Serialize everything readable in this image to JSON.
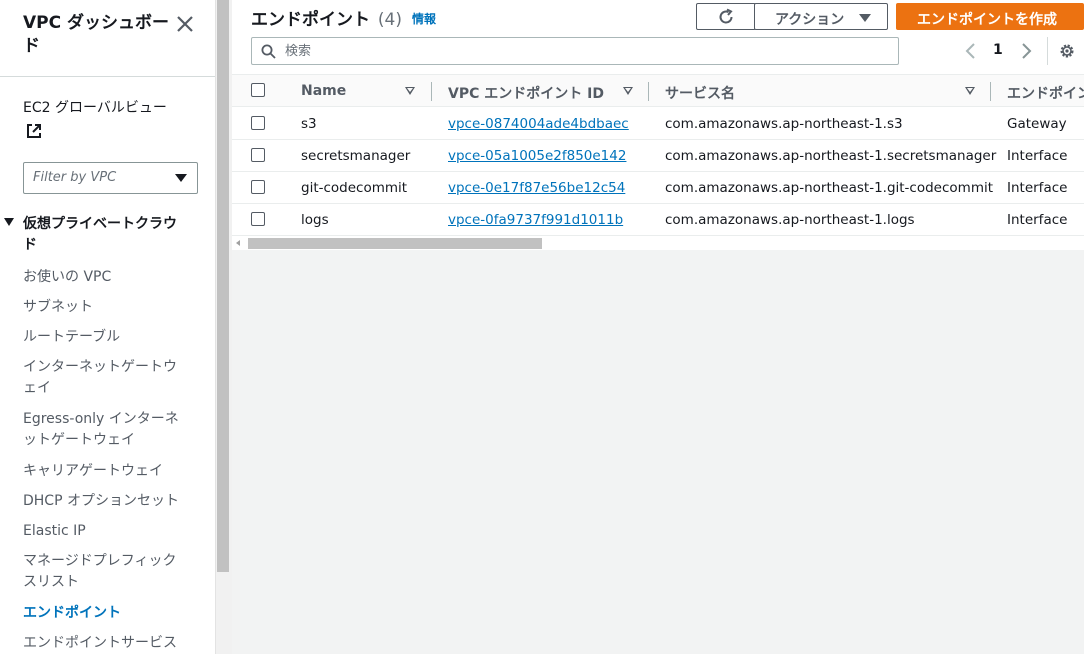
{
  "sidebar": {
    "title": "VPC ダッシュボード",
    "close_icon": "close-icon",
    "ec2_link": "EC2 グローバルビュー",
    "filter": {
      "placeholder": "Filter by VPC"
    },
    "section": "仮想プライベートクラウド",
    "items": [
      {
        "label": "お使いの VPC"
      },
      {
        "label": "サブネット"
      },
      {
        "label": "ルートテーブル"
      },
      {
        "label": "インターネットゲートウェイ"
      },
      {
        "label": "Egress-only インターネットゲートウェイ"
      },
      {
        "label": "キャリアゲートウェイ"
      },
      {
        "label": "DHCP オプションセット"
      },
      {
        "label": "Elastic IP"
      },
      {
        "label": "マネージドプレフィックスリスト"
      },
      {
        "label": "エンドポイント",
        "active": true
      },
      {
        "label": "エンドポイントサービス"
      }
    ]
  },
  "main": {
    "title": "エンドポイント",
    "count": "(4)",
    "info": "情報",
    "actions_label": "アクション",
    "create_label": "エンドポイントを作成",
    "search_placeholder": "検索",
    "page": "1",
    "columns": [
      "Name",
      "VPC エンドポイント ID",
      "サービス名",
      "エンドポイン"
    ],
    "rows": [
      {
        "name": "s3",
        "id": "vpce-0874004ade4bdbaec",
        "service": "com.amazonaws.ap-northeast-1.s3",
        "type": "Gateway"
      },
      {
        "name": "secretsmanager",
        "id": "vpce-05a1005e2f850e142",
        "service": "com.amazonaws.ap-northeast-1.secretsmanager",
        "type": "Interface"
      },
      {
        "name": "git-codecommit",
        "id": "vpce-0e17f87e56be12c54",
        "service": "com.amazonaws.ap-northeast-1.git-codecommit",
        "type": "Interface"
      },
      {
        "name": "logs",
        "id": "vpce-0fa9737f991d1011b",
        "service": "com.amazonaws.ap-northeast-1.logs",
        "type": "Interface"
      }
    ]
  },
  "colors": {
    "accent": "#0073bb",
    "primary_button": "#ec7211"
  }
}
